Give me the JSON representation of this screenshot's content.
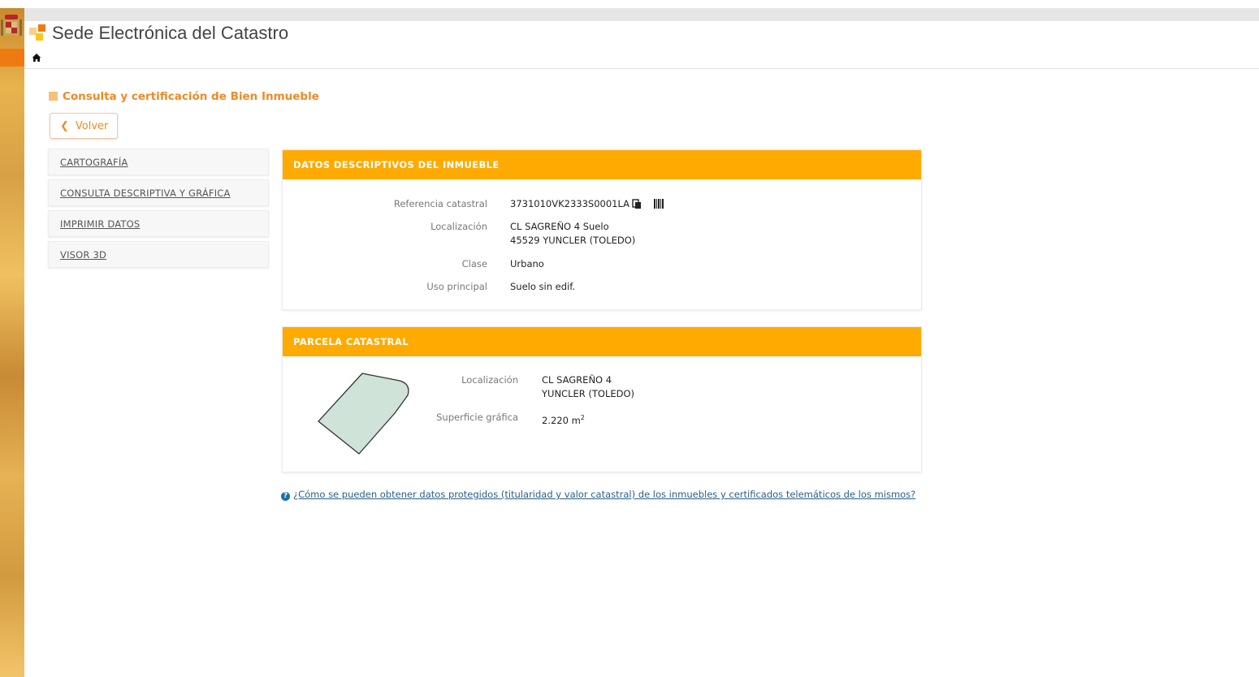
{
  "header": {
    "site_title": "Sede Electrónica del Catastro"
  },
  "page": {
    "heading": "Consulta y certificación de Bien Inmueble",
    "back_label": "Volver"
  },
  "sidebar": {
    "items": [
      {
        "label": "CARTOGRAFÍA"
      },
      {
        "label": "CONSULTA DESCRIPTIVA Y GRÁFICA"
      },
      {
        "label": "IMPRIMIR DATOS"
      },
      {
        "label": "VISOR 3D"
      }
    ]
  },
  "datos": {
    "title": "DATOS DESCRIPTIVOS DEL INMUEBLE",
    "referencia_label": "Referencia catastral",
    "referencia_value": "3731010VK2333S0001LA",
    "localizacion_label": "Localización",
    "localizacion_line1": "CL SAGREÑO 4 Suelo",
    "localizacion_line2": "45529 YUNCLER (TOLEDO)",
    "clase_label": "Clase",
    "clase_value": "Urbano",
    "uso_label": "Uso principal",
    "uso_value": "Suelo sin edif."
  },
  "parcela": {
    "title": "PARCELA CATASTRAL",
    "localizacion_label": "Localización",
    "localizacion_line1": "CL SAGREÑO 4",
    "localizacion_line2": "YUNCLER (TOLEDO)",
    "superficie_label": "Superficie gráfica",
    "superficie_value": "2.220 m",
    "superficie_unit_sup": "2"
  },
  "help": {
    "link_text": "¿Cómo se pueden obtener datos protegidos (titularidad y valor catastral) de los inmuebles y certificados telemáticos de los mismos?"
  },
  "colors": {
    "accent": "#ffaa00",
    "heading": "#f08a24",
    "parcel_fill": "#cfe3d9"
  },
  "icons": {
    "home": "home-icon",
    "copy": "copy-icon",
    "barcode": "barcode-icon",
    "help": "help-circle-icon",
    "back": "chevron-left-icon"
  }
}
